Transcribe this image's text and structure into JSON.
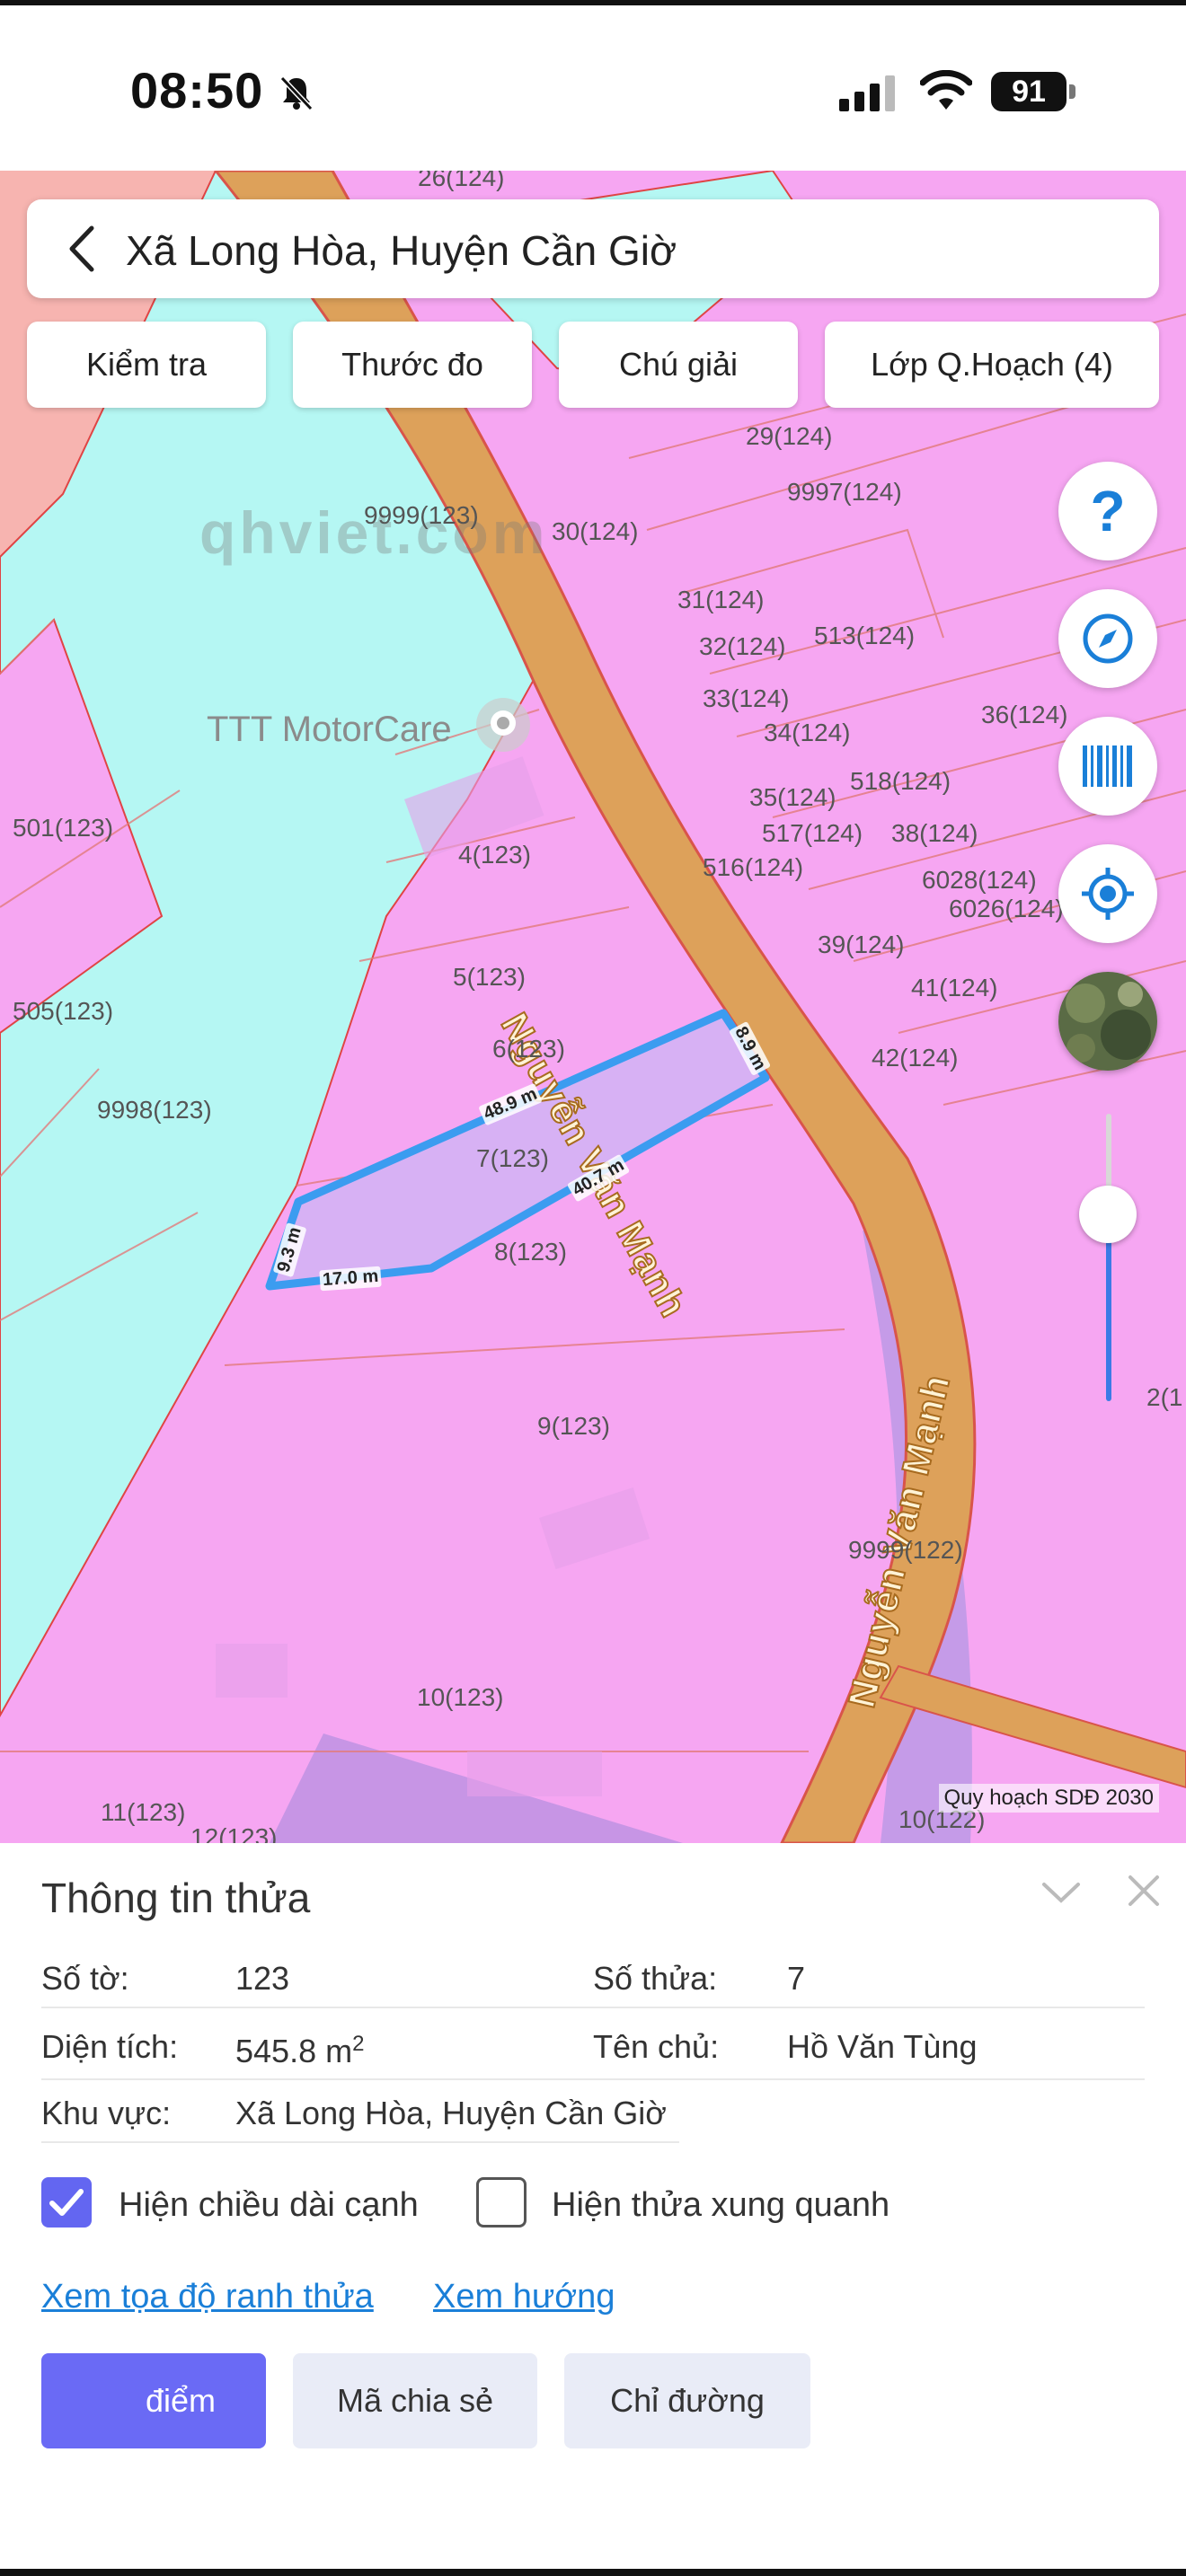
{
  "status_bar": {
    "time": "08:50",
    "battery": "91"
  },
  "search": {
    "title": "Xã Long Hòa, Huyện Cần Giờ"
  },
  "toolbar": {
    "check": "Kiểm tra",
    "measure": "Thước đo",
    "legend": "Chú giải",
    "layers": "Lớp Q.Hoạch (4)"
  },
  "map": {
    "poi": "TTT MotorCare",
    "watermark": "qhviet.com",
    "road": "Nguyễn Văn Mạnh",
    "plan_caption": "Quy hoạch SDĐ 2030",
    "edges": {
      "top": "48.9 m",
      "right": "8.9 m",
      "bottom_right": "40.7 m",
      "bottom_left": "17.0 m",
      "left": "9.3 m"
    },
    "parcels": [
      "26(124)",
      "29(124)",
      "9997(124)",
      "9999(123)",
      "30(124)",
      "31(124)",
      "32(124)",
      "513(124)",
      "33(124)",
      "34(124)",
      "36(124)",
      "518(124)",
      "35(124)",
      "517(124)",
      "38(124)",
      "516(124)",
      "6028(124)",
      "6026(124)",
      "501(123)",
      "4(123)",
      "39(124)",
      "41(124)",
      "5(123)",
      "505(123)",
      "6(123)",
      "42(124)",
      "9998(123)",
      "7(123)",
      "8(123)",
      "9(123)",
      "9999(122)",
      "10(123)",
      "11(123)",
      "12(123)",
      "10(122)",
      "2(1"
    ]
  },
  "controls": {
    "help": "?",
    "slider_level": 0.65
  },
  "sheet": {
    "title": "Thông tin thửa",
    "so_to_label": "Số tờ:",
    "so_to_value": "123",
    "so_thua_label": "Số thửa:",
    "so_thua_value": "7",
    "dien_tich_label": "Diện tích:",
    "dien_tich_value": "545.8 m",
    "dien_tich_unit_sup": "2",
    "ten_chu_label": "Tên chủ:",
    "ten_chu_value": "Hồ Văn Tùng",
    "khu_vuc_label": "Khu vực:",
    "khu_vuc_value": "Xã Long Hòa, Huyện Cần Giờ",
    "show_edge_length": {
      "label": "Hiện chiều dài cạnh",
      "checked": true
    },
    "show_neighbors": {
      "label": "Hiện thửa xung quanh",
      "checked": false
    },
    "link_coords": "Xem tọa độ ranh thửa",
    "link_direction": "Xem hướng",
    "btn_save": "điểm",
    "btn_share": "Mã chia sẻ",
    "btn_route": "Chỉ đường"
  },
  "colors": {
    "residential": "#f6a6f2",
    "water": "#b5f7f3",
    "road": "#dda15a",
    "parcel_outline": "#3b9cf0",
    "accent": "#6a6af5"
  }
}
